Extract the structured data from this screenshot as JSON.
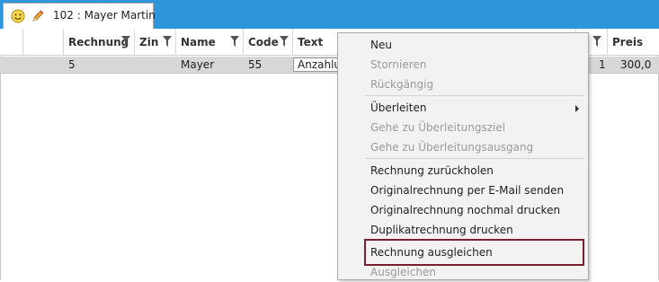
{
  "tab": {
    "id_label": "102 :",
    "name": "Mayer Martin",
    "icons": [
      "smiley-icon",
      "pencil-icon"
    ]
  },
  "grid": {
    "columns": [
      "Rechnung",
      "Zin",
      "Name",
      "Code",
      "Text",
      "Preis"
    ],
    "row": {
      "rechnung": "5",
      "name": "Mayer",
      "code": "55",
      "text": "Anzahlu",
      "qty": "1",
      "preis": "300,0"
    }
  },
  "menu": {
    "items": [
      {
        "label": "Neu",
        "enabled": true
      },
      {
        "label": "Stornieren",
        "enabled": false
      },
      {
        "label": "Rückgängig",
        "enabled": false
      },
      {
        "label": "Überleiten",
        "enabled": true,
        "submenu": true
      },
      {
        "label": "Gehe zu Überleitungsziel",
        "enabled": false
      },
      {
        "label": "Gehe zu Überleitungsausgang",
        "enabled": false
      },
      {
        "label": "Rechnung zurückholen",
        "enabled": true
      },
      {
        "label": "Originalrechnung per E-Mail senden",
        "enabled": true
      },
      {
        "label": "Originalrechnung nochmal drucken",
        "enabled": true
      },
      {
        "label": "Duplikatrechnung drucken",
        "enabled": true
      },
      {
        "label": "Rechnung ausgleichen",
        "enabled": true,
        "highlighted": true
      },
      {
        "label": "Ausgleichen",
        "enabled": false
      }
    ]
  },
  "colors": {
    "titlebar": "#2d95d9",
    "highlight_border": "#7a1f2e",
    "selected_row": "#d7d7d7"
  }
}
